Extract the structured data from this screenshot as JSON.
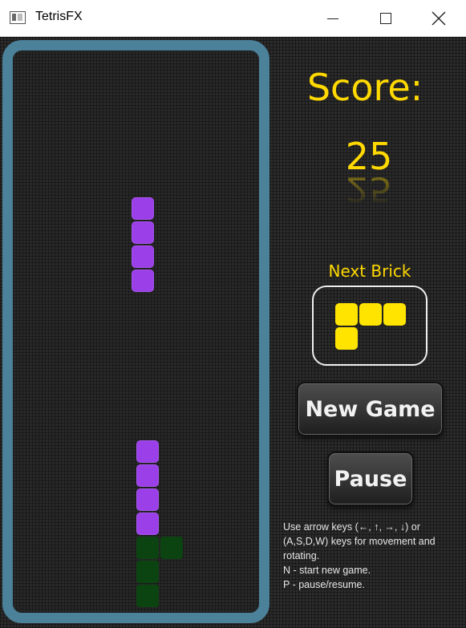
{
  "window": {
    "title": "TetrisFX"
  },
  "score": {
    "label": "Score:",
    "value": "25"
  },
  "next_brick": {
    "label": "Next Brick",
    "shape": "L",
    "color": "#ffe400"
  },
  "buttons": {
    "new_game": "New Game",
    "pause": "Pause"
  },
  "instructions": [
    "Use arrow keys (←, ↑, →, ↓) or (A,S,D,W) keys for movement and rotating.",
    "N - start new game.",
    "P - pause/resume."
  ],
  "colors": {
    "accent": "#ffd900",
    "board_border": "#4b8199",
    "falling_piece": "#9b3fe8",
    "stacked_purple": "#9b3fe8",
    "stacked_green": "#0b4410"
  }
}
